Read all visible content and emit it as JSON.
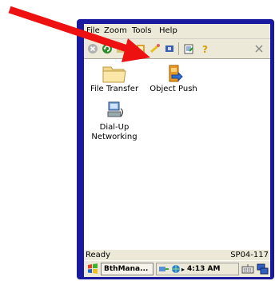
{
  "menubar": {
    "items": [
      {
        "label": "File"
      },
      {
        "label": "Zoom"
      },
      {
        "label": "Tools"
      },
      {
        "label": "Help"
      }
    ]
  },
  "toolbar": {
    "buttons": [
      "stop-icon",
      "refresh-icon",
      "folder-up-icon",
      "bluetooth-icon",
      "connect-icon",
      "disconnect-icon",
      "properties-icon",
      "help-icon",
      "close-icon"
    ]
  },
  "apps": [
    {
      "label": "File Transfer",
      "icon": "folder-icon"
    },
    {
      "label": "Object Push",
      "icon": "object-push-icon"
    },
    {
      "label_line1": "Dial-Up",
      "label_line2": "Networking",
      "icon": "dialup-icon"
    }
  ],
  "status": {
    "left": "Ready",
    "right": "SP04-117"
  },
  "taskbar": {
    "task_label": "BthMana...",
    "clock": "4:13 AM"
  },
  "colors": {
    "arrow": "#ee1111",
    "device_frame": "#1a1aa0",
    "chrome": "#ece9d8"
  }
}
